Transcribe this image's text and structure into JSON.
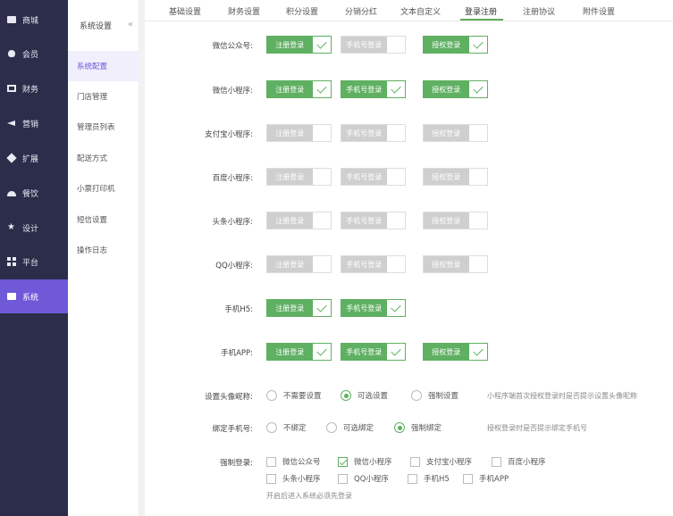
{
  "nav": {
    "items": [
      {
        "label": "商城",
        "icon": "store-icon"
      },
      {
        "label": "会员",
        "icon": "member-icon"
      },
      {
        "label": "财务",
        "icon": "finance-icon"
      },
      {
        "label": "营销",
        "icon": "megaphone-icon"
      },
      {
        "label": "扩展",
        "icon": "extension-icon"
      },
      {
        "label": "餐饮",
        "icon": "dining-icon"
      },
      {
        "label": "设计",
        "icon": "design-icon"
      },
      {
        "label": "平台",
        "icon": "grid-icon"
      },
      {
        "label": "系统",
        "icon": "system-icon"
      }
    ],
    "active_index": 8
  },
  "subnav": {
    "title": "系统设置",
    "collapse_glyph": "«",
    "items": [
      "系统配置",
      "门店管理",
      "管理员列表",
      "配送方式",
      "小票打印机",
      "短信设置",
      "操作日志"
    ],
    "active_index": 0
  },
  "tabs": {
    "items": [
      "基础设置",
      "财务设置",
      "积分设置",
      "分销分红",
      "文本自定义",
      "登录注册",
      "注册协议",
      "附件设置"
    ],
    "active_index": 5
  },
  "login_rows": [
    {
      "label": "微信公众号:",
      "toggles": [
        {
          "text": "注册登录",
          "on": true
        },
        {
          "text": "手机号登录",
          "on": false
        },
        {
          "text": "授权登录",
          "on": true
        }
      ]
    },
    {
      "label": "微信小程序:",
      "toggles": [
        {
          "text": "注册登录",
          "on": true
        },
        {
          "text": "手机号登录",
          "on": true
        },
        {
          "text": "授权登录",
          "on": true
        }
      ]
    },
    {
      "label": "支付宝小程序:",
      "toggles": [
        {
          "text": "注册登录",
          "on": false
        },
        {
          "text": "手机号登录",
          "on": false
        },
        {
          "text": "授权登录",
          "on": false
        }
      ]
    },
    {
      "label": "百度小程序:",
      "toggles": [
        {
          "text": "注册登录",
          "on": false
        },
        {
          "text": "手机号登录",
          "on": false
        },
        {
          "text": "授权登录",
          "on": false
        }
      ]
    },
    {
      "label": "头条小程序:",
      "toggles": [
        {
          "text": "注册登录",
          "on": false
        },
        {
          "text": "手机号登录",
          "on": false
        },
        {
          "text": "授权登录",
          "on": false
        }
      ]
    },
    {
      "label": "QQ小程序:",
      "toggles": [
        {
          "text": "注册登录",
          "on": false
        },
        {
          "text": "手机号登录",
          "on": false
        },
        {
          "text": "授权登录",
          "on": false
        }
      ]
    },
    {
      "label": "手机H5:",
      "toggles": [
        {
          "text": "注册登录",
          "on": true
        },
        {
          "text": "手机号登录",
          "on": true
        }
      ]
    },
    {
      "label": "手机APP:",
      "toggles": [
        {
          "text": "注册登录",
          "on": true
        },
        {
          "text": "手机号登录",
          "on": true
        },
        {
          "text": "授权登录",
          "on": true
        }
      ]
    }
  ],
  "avatar_setting": {
    "label": "设置头像昵称:",
    "options": [
      "不需要设置",
      "可选设置",
      "强制设置"
    ],
    "selected": 1,
    "hint": "小程序端首次授权登录时是否提示设置头像昵称"
  },
  "bind_phone": {
    "label": "绑定手机号:",
    "options": [
      "不绑定",
      "可选绑定",
      "强制绑定"
    ],
    "selected": 2,
    "hint": "授权登录时是否提示绑定手机号"
  },
  "force_login": {
    "label": "强制登录:",
    "row1": [
      {
        "text": "微信公众号",
        "checked": false
      },
      {
        "text": "微信小程序",
        "checked": true
      },
      {
        "text": "支付宝小程序",
        "checked": false
      },
      {
        "text": "百度小程序",
        "checked": false
      }
    ],
    "row2": [
      {
        "text": "头条小程序",
        "checked": false
      },
      {
        "text": "QQ小程序",
        "checked": false
      },
      {
        "text": "手机H5",
        "checked": false
      },
      {
        "text": "手机APP",
        "checked": false
      }
    ],
    "note": "开启后进入系统必须先登录"
  },
  "colors": {
    "accent_green": "#5fb062",
    "nav_bg": "#2b2d4a",
    "nav_active": "#6f59d9"
  }
}
